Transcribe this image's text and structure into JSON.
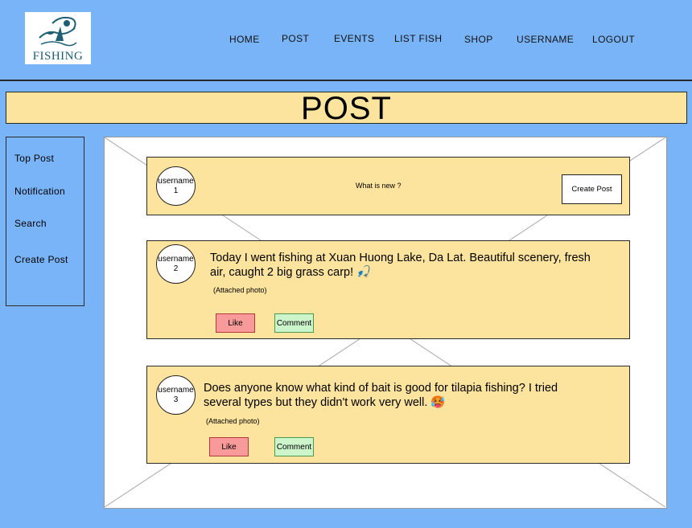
{
  "app": {
    "logo_text": "FISHING"
  },
  "nav": {
    "items": [
      "HOME",
      "POST",
      "EVENTS",
      "LIST FISH",
      "SHOP",
      "USERNAME",
      "LOGOUT"
    ]
  },
  "banner": {
    "title": "POST"
  },
  "sidebar": {
    "items": [
      "Top Post",
      "Notification",
      "Search",
      "Create Post"
    ]
  },
  "composer": {
    "avatar": "username 1",
    "prompt": "What is new ?",
    "button": "Create Post"
  },
  "posts": [
    {
      "avatar": "username 2",
      "text": "Today I went fishing at Xuan Huong Lake, Da Lat. Beautiful scenery, fresh air, caught 2 big grass carp! 🎣",
      "attachment": "(Attached photo)",
      "like": "Like",
      "comment": "Comment"
    },
    {
      "avatar": "username 3",
      "text": "Does anyone know what kind of bait is good for tilapia fishing? I tried several types but they didn't work very well. 🥵",
      "attachment": "(Attached photo)",
      "like": "Like",
      "comment": "Comment"
    }
  ],
  "colors": {
    "background": "#7ab4f8",
    "banner": "#fce39e",
    "card": "#fce39e",
    "like": "#f89a99",
    "comment": "#cdf5cc"
  }
}
